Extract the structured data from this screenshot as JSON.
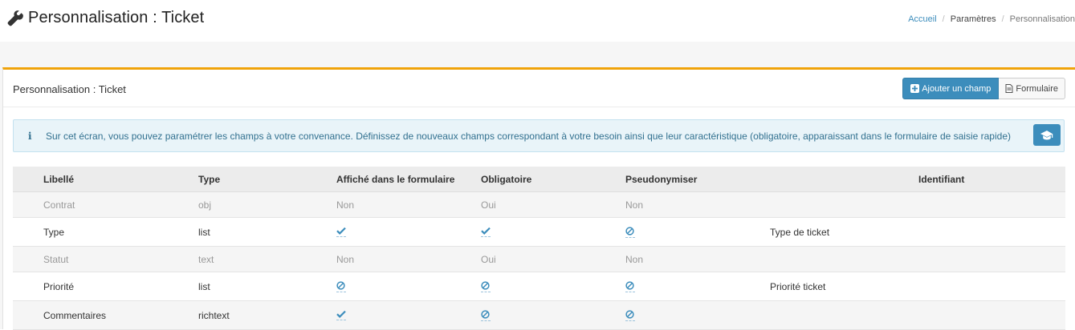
{
  "header": {
    "title": "Personnalisation : Ticket",
    "icon": "wrench-icon"
  },
  "breadcrumb": [
    "Accueil",
    "Paramètres",
    "Personnalisation"
  ],
  "box": {
    "title": "Personnalisation : Ticket",
    "add_button": "Ajouter un champ",
    "form_button": "Formulaire",
    "accent_color": "#f0a30a",
    "primary_color": "#3c8dbc"
  },
  "callout": {
    "text": "Sur cet écran, vous pouvez paramétrer les champs à votre convenance. Définissez de nouveaux champs correspondant à votre besoin ainsi que leur caractéristique (obligatoire, apparaissant dans le formulaire de saisie rapide)",
    "icon": "info-icon",
    "help_icon": "graduation-cap-icon"
  },
  "table": {
    "columns": [
      "Libellé",
      "Type",
      "Affiché dans le formulaire",
      "Obligatoire",
      "Pseudonymiser",
      "",
      "Identifiant"
    ],
    "rows": [
      {
        "label": "Contrat",
        "type": "obj",
        "display": "Non",
        "mandatory": "Oui",
        "pseudo": "Non",
        "extra": "",
        "muted": true
      },
      {
        "label": "Type",
        "type": "list",
        "display": "check",
        "mandatory": "check",
        "pseudo": "ban",
        "extra": "Type de ticket",
        "muted": false
      },
      {
        "label": "Statut",
        "type": "text",
        "display": "Non",
        "mandatory": "Oui",
        "pseudo": "Non",
        "extra": "",
        "muted": true
      },
      {
        "label": "Priorité",
        "type": "list",
        "display": "ban",
        "mandatory": "ban",
        "pseudo": "ban",
        "extra": "Priorité ticket",
        "muted": false
      },
      {
        "label": "Commentaires",
        "type": "richtext",
        "display": "check",
        "mandatory": "ban",
        "pseudo": "ban",
        "extra": "",
        "muted": false
      }
    ]
  }
}
